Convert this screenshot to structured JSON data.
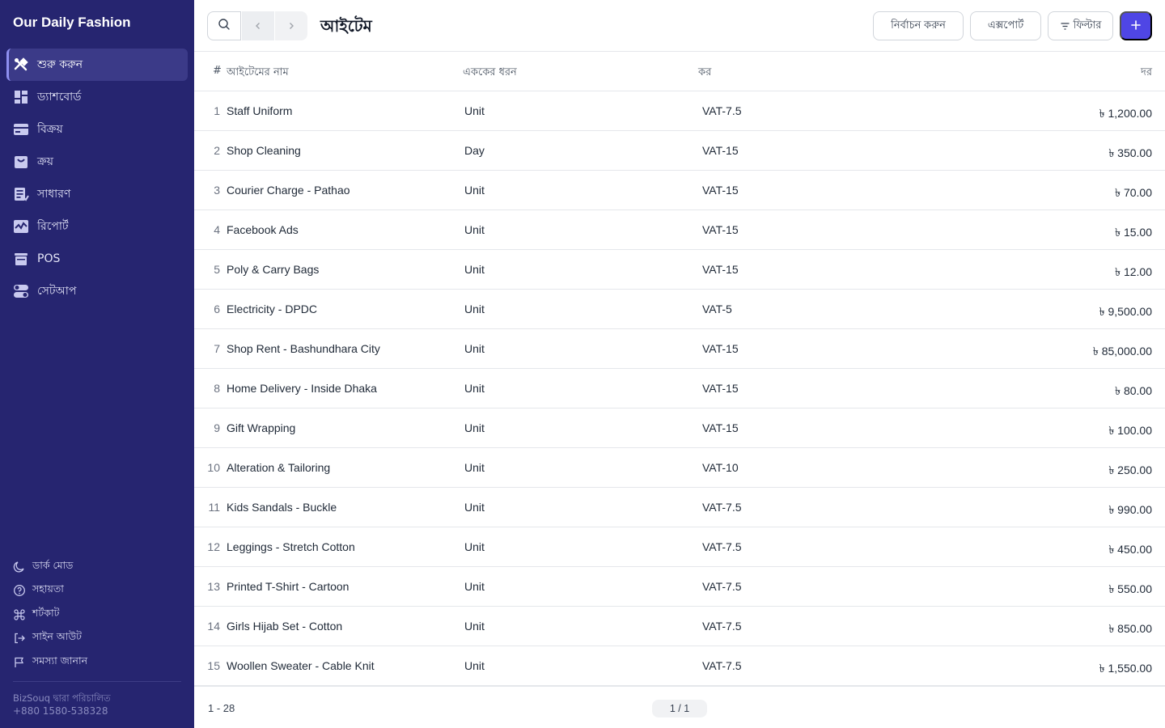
{
  "brand": "Our Daily Fashion",
  "nav": [
    {
      "label": "শুরু করুন",
      "icon": "tools-icon",
      "active": true
    },
    {
      "label": "ড্যাশবোর্ড",
      "icon": "dashboard-icon",
      "active": false
    },
    {
      "label": "বিক্রয়",
      "icon": "credit-card-icon",
      "active": false
    },
    {
      "label": "ক্রয়",
      "icon": "shopping-bag-icon",
      "active": false
    },
    {
      "label": "সাধারণ",
      "icon": "ledger-icon",
      "active": false
    },
    {
      "label": "রিপোর্ট",
      "icon": "report-icon",
      "active": false
    },
    {
      "label": "POS",
      "icon": "pos-icon",
      "active": false
    },
    {
      "label": "সেটআপ",
      "icon": "toggle-icon",
      "active": false
    }
  ],
  "bottom_links": [
    {
      "label": "ডার্ক মোড",
      "icon": "moon-icon"
    },
    {
      "label": "সহায়তা",
      "icon": "help-icon"
    },
    {
      "label": "শর্টকাট",
      "icon": "command-icon"
    },
    {
      "label": "সাইন আউট",
      "icon": "sign-out-icon"
    },
    {
      "label": "সমস্যা জানান",
      "icon": "flag-icon"
    }
  ],
  "footer": {
    "powered_by": "BizSouq দ্বারা পরিচালিত",
    "phone": "+880 1580-538328"
  },
  "header": {
    "title": "আইটেম",
    "select_label": "নির্বাচন করুন",
    "export_label": "এক্সপোর্ট",
    "filter_label": "ফিল্টার",
    "add_label": "+"
  },
  "table": {
    "columns": {
      "no": "#",
      "name": "আইটেমের নাম",
      "unit": "এককের ধরন",
      "tax": "কর",
      "rate": "দর"
    },
    "rows": [
      {
        "no": "1",
        "name": "Staff Uniform",
        "unit": "Unit",
        "tax": "VAT-7.5",
        "rate": "৳ 1,200.00"
      },
      {
        "no": "2",
        "name": "Shop Cleaning",
        "unit": "Day",
        "tax": "VAT-15",
        "rate": "৳ 350.00"
      },
      {
        "no": "3",
        "name": "Courier Charge - Pathao",
        "unit": "Unit",
        "tax": "VAT-15",
        "rate": "৳ 70.00"
      },
      {
        "no": "4",
        "name": "Facebook Ads",
        "unit": "Unit",
        "tax": "VAT-15",
        "rate": "৳ 15.00"
      },
      {
        "no": "5",
        "name": "Poly & Carry Bags",
        "unit": "Unit",
        "tax": "VAT-15",
        "rate": "৳ 12.00"
      },
      {
        "no": "6",
        "name": "Electricity - DPDC",
        "unit": "Unit",
        "tax": "VAT-5",
        "rate": "৳ 9,500.00"
      },
      {
        "no": "7",
        "name": "Shop Rent - Bashundhara City",
        "unit": "Unit",
        "tax": "VAT-15",
        "rate": "৳ 85,000.00"
      },
      {
        "no": "8",
        "name": "Home Delivery - Inside Dhaka",
        "unit": "Unit",
        "tax": "VAT-15",
        "rate": "৳ 80.00"
      },
      {
        "no": "9",
        "name": "Gift Wrapping",
        "unit": "Unit",
        "tax": "VAT-15",
        "rate": "৳ 100.00"
      },
      {
        "no": "10",
        "name": "Alteration & Tailoring",
        "unit": "Unit",
        "tax": "VAT-10",
        "rate": "৳ 250.00"
      },
      {
        "no": "11",
        "name": "Kids Sandals - Buckle",
        "unit": "Unit",
        "tax": "VAT-7.5",
        "rate": "৳ 990.00"
      },
      {
        "no": "12",
        "name": "Leggings - Stretch Cotton",
        "unit": "Unit",
        "tax": "VAT-7.5",
        "rate": "৳ 450.00"
      },
      {
        "no": "13",
        "name": "Printed T-Shirt - Cartoon",
        "unit": "Unit",
        "tax": "VAT-7.5",
        "rate": "৳ 550.00"
      },
      {
        "no": "14",
        "name": "Girls Hijab Set - Cotton",
        "unit": "Unit",
        "tax": "VAT-7.5",
        "rate": "৳ 850.00"
      },
      {
        "no": "15",
        "name": "Woollen Sweater - Cable Knit",
        "unit": "Unit",
        "tax": "VAT-7.5",
        "rate": "৳ 1,550.00"
      }
    ]
  },
  "pagination": {
    "range": "1 - 28",
    "page": "1 / 1"
  },
  "colors": {
    "sidebar": "#262570",
    "accent": "#4f46e5"
  }
}
